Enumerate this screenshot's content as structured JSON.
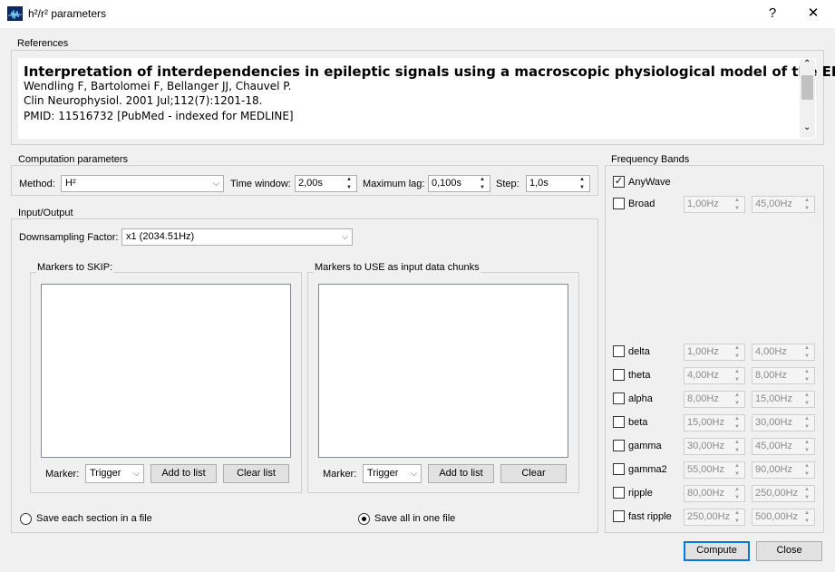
{
  "window": {
    "title": "h²/r² parameters",
    "help_glyph": "?",
    "close_glyph": "✕"
  },
  "references": {
    "label": "References",
    "title": "Interpretation of interdependencies in epileptic signals using a macroscopic physiological model of the EEG.",
    "authors": "Wendling F, Bartolomei F, Bellanger JJ, Chauvel P.",
    "journal": "Clin Neurophysiol. 2001 Jul;112(7):1201-18.",
    "pmid": "PMID: 11516732 [PubMed - indexed for MEDLINE]"
  },
  "computation": {
    "label": "Computation parameters",
    "method_label": "Method:",
    "method_value": "H²",
    "time_window_label": "Time window:",
    "time_window_value": "2,00s",
    "max_lag_label": "Maximum lag:",
    "max_lag_value": "0,100s",
    "step_label": "Step:",
    "step_value": "1,0s"
  },
  "io": {
    "label": "Input/Output",
    "downsampling_label": "Downsampling Factor:",
    "downsampling_value": "x1 (2034.51Hz)",
    "skip": {
      "label": "Markers to SKIP:",
      "marker_label": "Marker:",
      "marker_value": "Trigger",
      "add_button": "Add to list",
      "clear_button": "Clear list"
    },
    "use": {
      "label": "Markers to USE as input data chunks",
      "marker_label": "Marker:",
      "marker_value": "Trigger",
      "add_button": "Add to list",
      "clear_button": "Clear"
    },
    "save_each_label": "Save each section in a file",
    "save_all_label": "Save all in one file",
    "save_mode_selected": "Save all in one file"
  },
  "frequency_bands": {
    "label": "Frequency Bands",
    "anywave": {
      "label": "AnyWave",
      "checked": true
    },
    "broad": {
      "label": "Broad",
      "checked": false,
      "low": "1,00Hz",
      "high": "45,00Hz"
    },
    "bands": [
      {
        "label": "delta",
        "checked": false,
        "low": "1,00Hz",
        "high": "4,00Hz"
      },
      {
        "label": "theta",
        "checked": false,
        "low": "4,00Hz",
        "high": "8,00Hz"
      },
      {
        "label": "alpha",
        "checked": false,
        "low": "8,00Hz",
        "high": "15,00Hz"
      },
      {
        "label": "beta",
        "checked": false,
        "low": "15,00Hz",
        "high": "30,00Hz"
      },
      {
        "label": "gamma",
        "checked": false,
        "low": "30,00Hz",
        "high": "45,00Hz"
      },
      {
        "label": "gamma2",
        "checked": false,
        "low": "55,00Hz",
        "high": "90,00Hz"
      },
      {
        "label": "ripple",
        "checked": false,
        "low": "80,00Hz",
        "high": "250,00Hz"
      },
      {
        "label": "fast ripple",
        "checked": false,
        "low": "250,00Hz",
        "high": "500,00Hz"
      }
    ]
  },
  "actions": {
    "compute": "Compute",
    "close": "Close"
  },
  "icons": {
    "checkmark": "✓",
    "spin_up": "▲",
    "spin_down": "▼",
    "combo_arrow": "⌵",
    "scroll_up": "⌃",
    "scroll_down": "⌄"
  }
}
